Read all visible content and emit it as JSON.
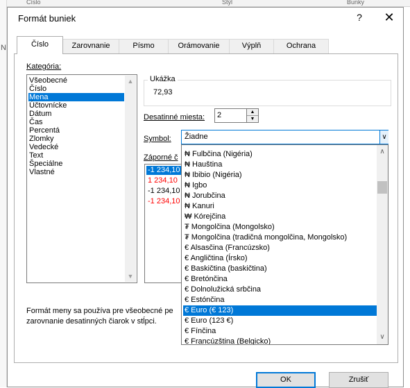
{
  "background": {
    "row_letter": "N",
    "header_fragments": [
      "Číslo",
      "Štýl",
      "Bunky"
    ]
  },
  "dialog": {
    "title": "Formát buniek",
    "help_glyph": "?",
    "close_glyph": "✕"
  },
  "tabs": [
    "Číslo",
    "Zarovnanie",
    "Písmo",
    "Orámovanie",
    "Výplň",
    "Ochrana"
  ],
  "active_tab": "Číslo",
  "category": {
    "label": "Kategória:",
    "items": [
      "Všeobecné",
      "Číslo",
      "Mena",
      "Účtovnícke",
      "Dátum",
      "Čas",
      "Percentá",
      "Zlomky",
      "Vedecké",
      "Text",
      "Špeciálne",
      "Vlastné"
    ],
    "selected": "Mena"
  },
  "sample": {
    "label": "Ukážka",
    "value": "72,93"
  },
  "decimal": {
    "label": "Desatinné miesta:",
    "value": "2"
  },
  "symbol": {
    "label": "Symbol:",
    "value": "Žiadne"
  },
  "negative": {
    "label": "Záporné č",
    "items": [
      {
        "text": "-1 234,10",
        "color": "#000000",
        "selected": true
      },
      {
        "text": "1 234,10",
        "color": "#ff0000",
        "selected": false
      },
      {
        "text": "-1 234,10",
        "color": "#000000",
        "selected": false
      },
      {
        "text": "-1 234,10",
        "color": "#ff0000",
        "selected": false
      }
    ]
  },
  "dropdown": {
    "items": [
      "₦ Fulbčina (Nigéria)",
      "₦ Hauština",
      "₦ Ibibio (Nigéria)",
      "₦ Igbo",
      "₦ Jorubčina",
      "₦ Kanuri",
      "₩ Kórejčina",
      "₮ Mongolčina (Mongolsko)",
      "₮ Mongolčina (tradičná mongolčina, Mongolsko)",
      "€ Alsasčina (Francúzsko)",
      "€ Angličtina (Írsko)",
      "€ Baskičtina (baskičtina)",
      "€ Bretónčina",
      "€ Dolnolužická srbčina",
      "€ Estónčina",
      "€ Euro (€ 123)",
      "€ Euro (123 €)",
      "€ Fínčina",
      "€ Francúzština (Belgicko)"
    ],
    "selected": "€ Euro (€ 123)"
  },
  "description": {
    "line1": "Formát meny sa používa pre všeobecné pe",
    "line2": "zarovnanie desatinných čiarok v stĺpci."
  },
  "buttons": {
    "ok": "OK",
    "cancel": "Zrušiť"
  },
  "colors": {
    "accent": "#0078d7",
    "negative_red": "#ff0000"
  }
}
